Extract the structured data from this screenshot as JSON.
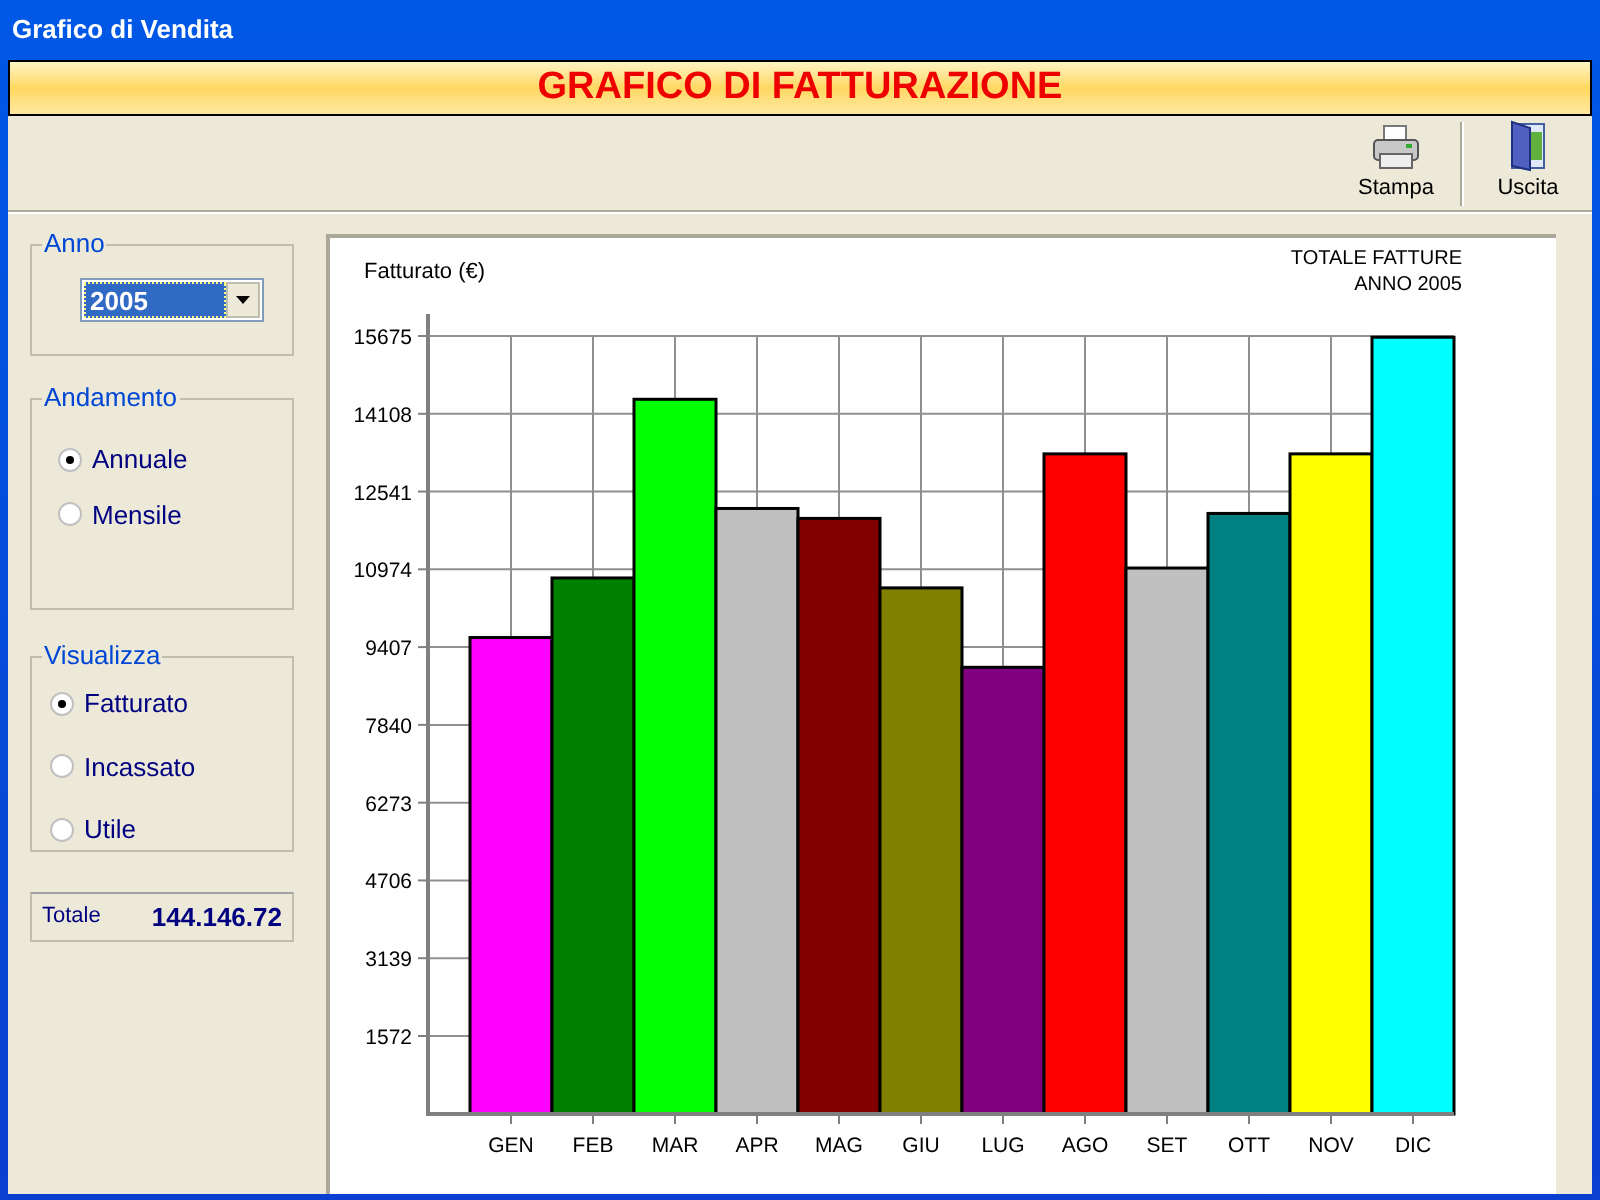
{
  "window": {
    "title": "Grafico di Vendita"
  },
  "banner": {
    "title": "GRAFICO DI FATTURAZIONE"
  },
  "toolbar": {
    "buttons": [
      {
        "label": "Stampa",
        "kind": "print"
      },
      {
        "label": "Uscita",
        "kind": "exit"
      }
    ]
  },
  "anno": {
    "legend": "Anno",
    "value": "2005"
  },
  "andamento": {
    "legend": "Andamento",
    "options": [
      {
        "label": "Annuale",
        "selected": true
      },
      {
        "label": "Mensile",
        "selected": false
      }
    ]
  },
  "visualizza": {
    "legend": "Visualizza",
    "options": [
      {
        "label": "Fatturato",
        "selected": true
      },
      {
        "label": "Incassato",
        "selected": false
      },
      {
        "label": "Utile",
        "selected": false
      }
    ]
  },
  "totale": {
    "label": "Totale",
    "value": "144.146.72"
  },
  "chart": {
    "caption": [
      "TOTALE FATTURE",
      "ANNO 2005"
    ],
    "chart_data": {
      "type": "bar",
      "ylabel": "Fatturato (€)",
      "categories": [
        "GEN",
        "FEB",
        "MAR",
        "APR",
        "MAG",
        "GIU",
        "LUG",
        "AGO",
        "SET",
        "OTT",
        "NOV",
        "DIC"
      ],
      "series": [
        {
          "values": [
            9600,
            10800,
            14400,
            12200,
            12000,
            10600,
            9000,
            13300,
            11000,
            12100,
            13300,
            15650
          ]
        }
      ],
      "grid": true,
      "ylim": [
        0,
        15675
      ],
      "yticks": [
        1572,
        3139,
        4706,
        6273,
        7840,
        9407,
        10974,
        12541,
        14108,
        15675
      ]
    },
    "bars": [
      {
        "color": "#ff00ff"
      },
      {
        "color": "#008000"
      },
      {
        "color": "#00ff00"
      },
      {
        "color": "#c0c0c0"
      },
      {
        "color": "#800000"
      },
      {
        "color": "#808000"
      },
      {
        "color": "#800080"
      },
      {
        "color": "#ff0000"
      },
      {
        "color": "#c0c0c0"
      },
      {
        "color": "#008080"
      },
      {
        "color": "#ffff00"
      },
      {
        "color": "#00ffff"
      }
    ]
  }
}
